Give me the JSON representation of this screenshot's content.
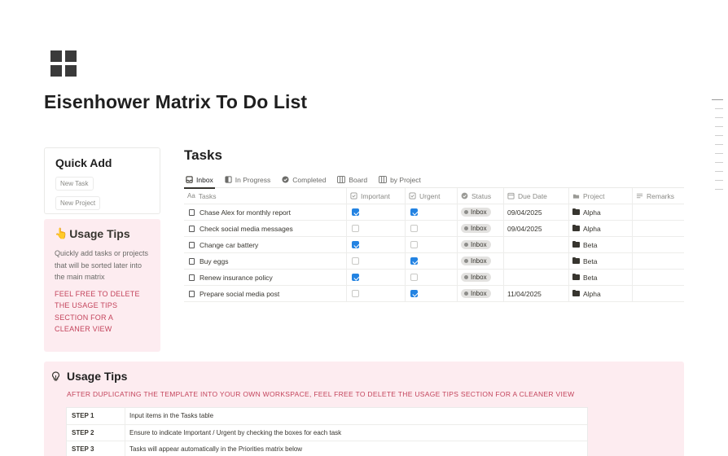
{
  "page": {
    "icon": "grid-icon",
    "title": "Eisenhower Matrix To Do List"
  },
  "quick_add": {
    "title": "Quick Add",
    "buttons": [
      "New Task",
      "New Project"
    ]
  },
  "usage_tips_side": {
    "emoji": "👆",
    "title": "Usage Tips",
    "description": "Quickly add tasks or projects that will be sorted later into the main matrix",
    "warning": "FEEL FREE TO DELETE THE USAGE TIPS SECTION FOR A CLEANER VIEW"
  },
  "tasks": {
    "title": "Tasks",
    "tabs": [
      {
        "label": "Inbox",
        "icon": "inbox-icon",
        "active": true
      },
      {
        "label": "In Progress",
        "icon": "progress-icon",
        "active": false
      },
      {
        "label": "Completed",
        "icon": "check-circle-icon",
        "active": false
      },
      {
        "label": "Board",
        "icon": "board-icon",
        "active": false
      },
      {
        "label": "by Project",
        "icon": "board-icon",
        "active": false
      }
    ],
    "columns": {
      "task": "Tasks",
      "important": "Important",
      "urgent": "Urgent",
      "status": "Status",
      "due": "Due Date",
      "project": "Project",
      "remarks": "Remarks"
    },
    "rows": [
      {
        "task": "Chase Alex for monthly report",
        "important": true,
        "urgent": true,
        "status": "Inbox",
        "due": "09/04/2025",
        "project": "Alpha"
      },
      {
        "task": "Check social media messages",
        "important": false,
        "urgent": false,
        "status": "Inbox",
        "due": "09/04/2025",
        "project": "Alpha"
      },
      {
        "task": "Change car battery",
        "important": true,
        "urgent": false,
        "status": "Inbox",
        "due": "",
        "project": "Beta"
      },
      {
        "task": "Buy eggs",
        "important": false,
        "urgent": true,
        "status": "Inbox",
        "due": "",
        "project": "Beta"
      },
      {
        "task": "Renew insurance policy",
        "important": true,
        "urgent": false,
        "status": "Inbox",
        "due": "",
        "project": "Beta"
      },
      {
        "task": "Prepare social media post",
        "important": false,
        "urgent": true,
        "status": "Inbox",
        "due": "11/04/2025",
        "project": "Alpha"
      }
    ]
  },
  "usage_tips_main": {
    "icon": "lightbulb-icon",
    "title": "Usage Tips",
    "notice": "AFTER DUPLICATING THE TEMPLATE INTO YOUR OWN WORKSPACE, FEEL FREE TO DELETE THE USAGE TIPS SECTION FOR A CLEANER VIEW",
    "steps": [
      {
        "label": "STEP 1",
        "text": "Input items in the Tasks table"
      },
      {
        "label": "STEP 2",
        "text": "Ensure to indicate Important / Urgent by checking the boxes for each task"
      },
      {
        "label": "STEP 3",
        "text": "Tasks will appear automatically in the Priorities matrix below"
      }
    ]
  },
  "colors": {
    "accent_blue": "#2383e2",
    "tips_background": "#fdecf0",
    "warning_text": "#c4445c"
  }
}
